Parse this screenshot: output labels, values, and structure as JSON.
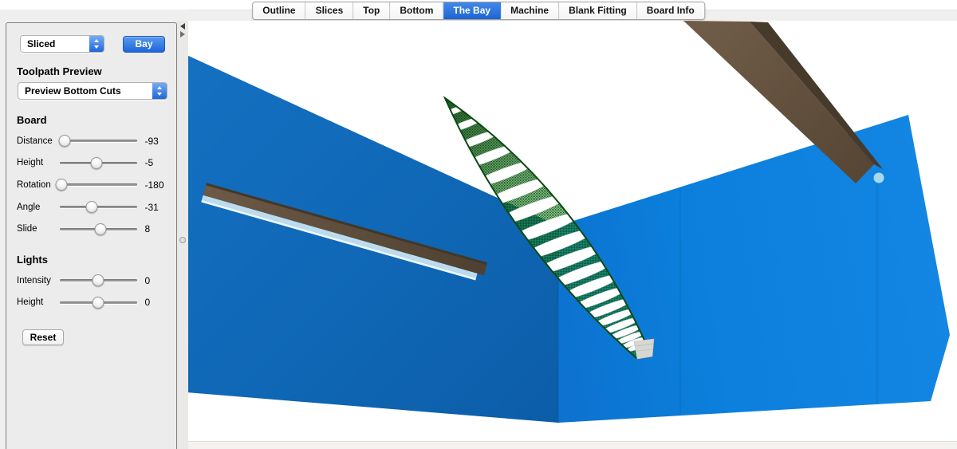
{
  "tabs": {
    "items": [
      {
        "label": "Outline",
        "selected": false
      },
      {
        "label": "Slices",
        "selected": false
      },
      {
        "label": "Top",
        "selected": false
      },
      {
        "label": "Bottom",
        "selected": false
      },
      {
        "label": "The Bay",
        "selected": true
      },
      {
        "label": "Machine",
        "selected": false
      },
      {
        "label": "Blank Fitting",
        "selected": false
      },
      {
        "label": "Board Info",
        "selected": false
      }
    ]
  },
  "sidebar": {
    "mode_select": {
      "value": "Sliced"
    },
    "bay_button_label": "Bay",
    "toolpath": {
      "heading": "Toolpath Preview",
      "select_value": "Preview Bottom Cuts"
    },
    "board": {
      "heading": "Board",
      "sliders": [
        {
          "label": "Distance",
          "value": "-93",
          "pos": 7
        },
        {
          "label": "Height",
          "value": "-5",
          "pos": 48
        },
        {
          "label": "Rotation",
          "value": "-180",
          "pos": 2
        },
        {
          "label": "Angle",
          "value": "-31",
          "pos": 42
        },
        {
          "label": "Slide",
          "value": "8",
          "pos": 53
        }
      ]
    },
    "lights": {
      "heading": "Lights",
      "sliders": [
        {
          "label": "Intensity",
          "value": "0",
          "pos": 50
        },
        {
          "label": "Height",
          "value": "0",
          "pos": 50
        }
      ]
    },
    "reset_button_label": "Reset"
  },
  "scene": {
    "slice_band_positions": [
      0.05,
      0.105,
      0.165,
      0.23,
      0.3,
      0.37,
      0.44,
      0.51,
      0.575,
      0.635,
      0.69,
      0.74,
      0.785,
      0.825,
      0.86,
      0.89,
      0.915,
      0.937,
      0.956,
      0.972
    ]
  },
  "colors": {
    "selected_tab_blue": "#1c64d3",
    "bay_button_blue": "#1b66dc",
    "wall_left_blue": "#0f67b5",
    "wall_right_blue": "#0b83e0",
    "board_green_dark": "#0c5c13",
    "board_green_light": "#259428",
    "slice_band_white": "#ffffff",
    "blank_brown": "#5d4c3a",
    "blank_foam_blue": "#bcdcee"
  }
}
